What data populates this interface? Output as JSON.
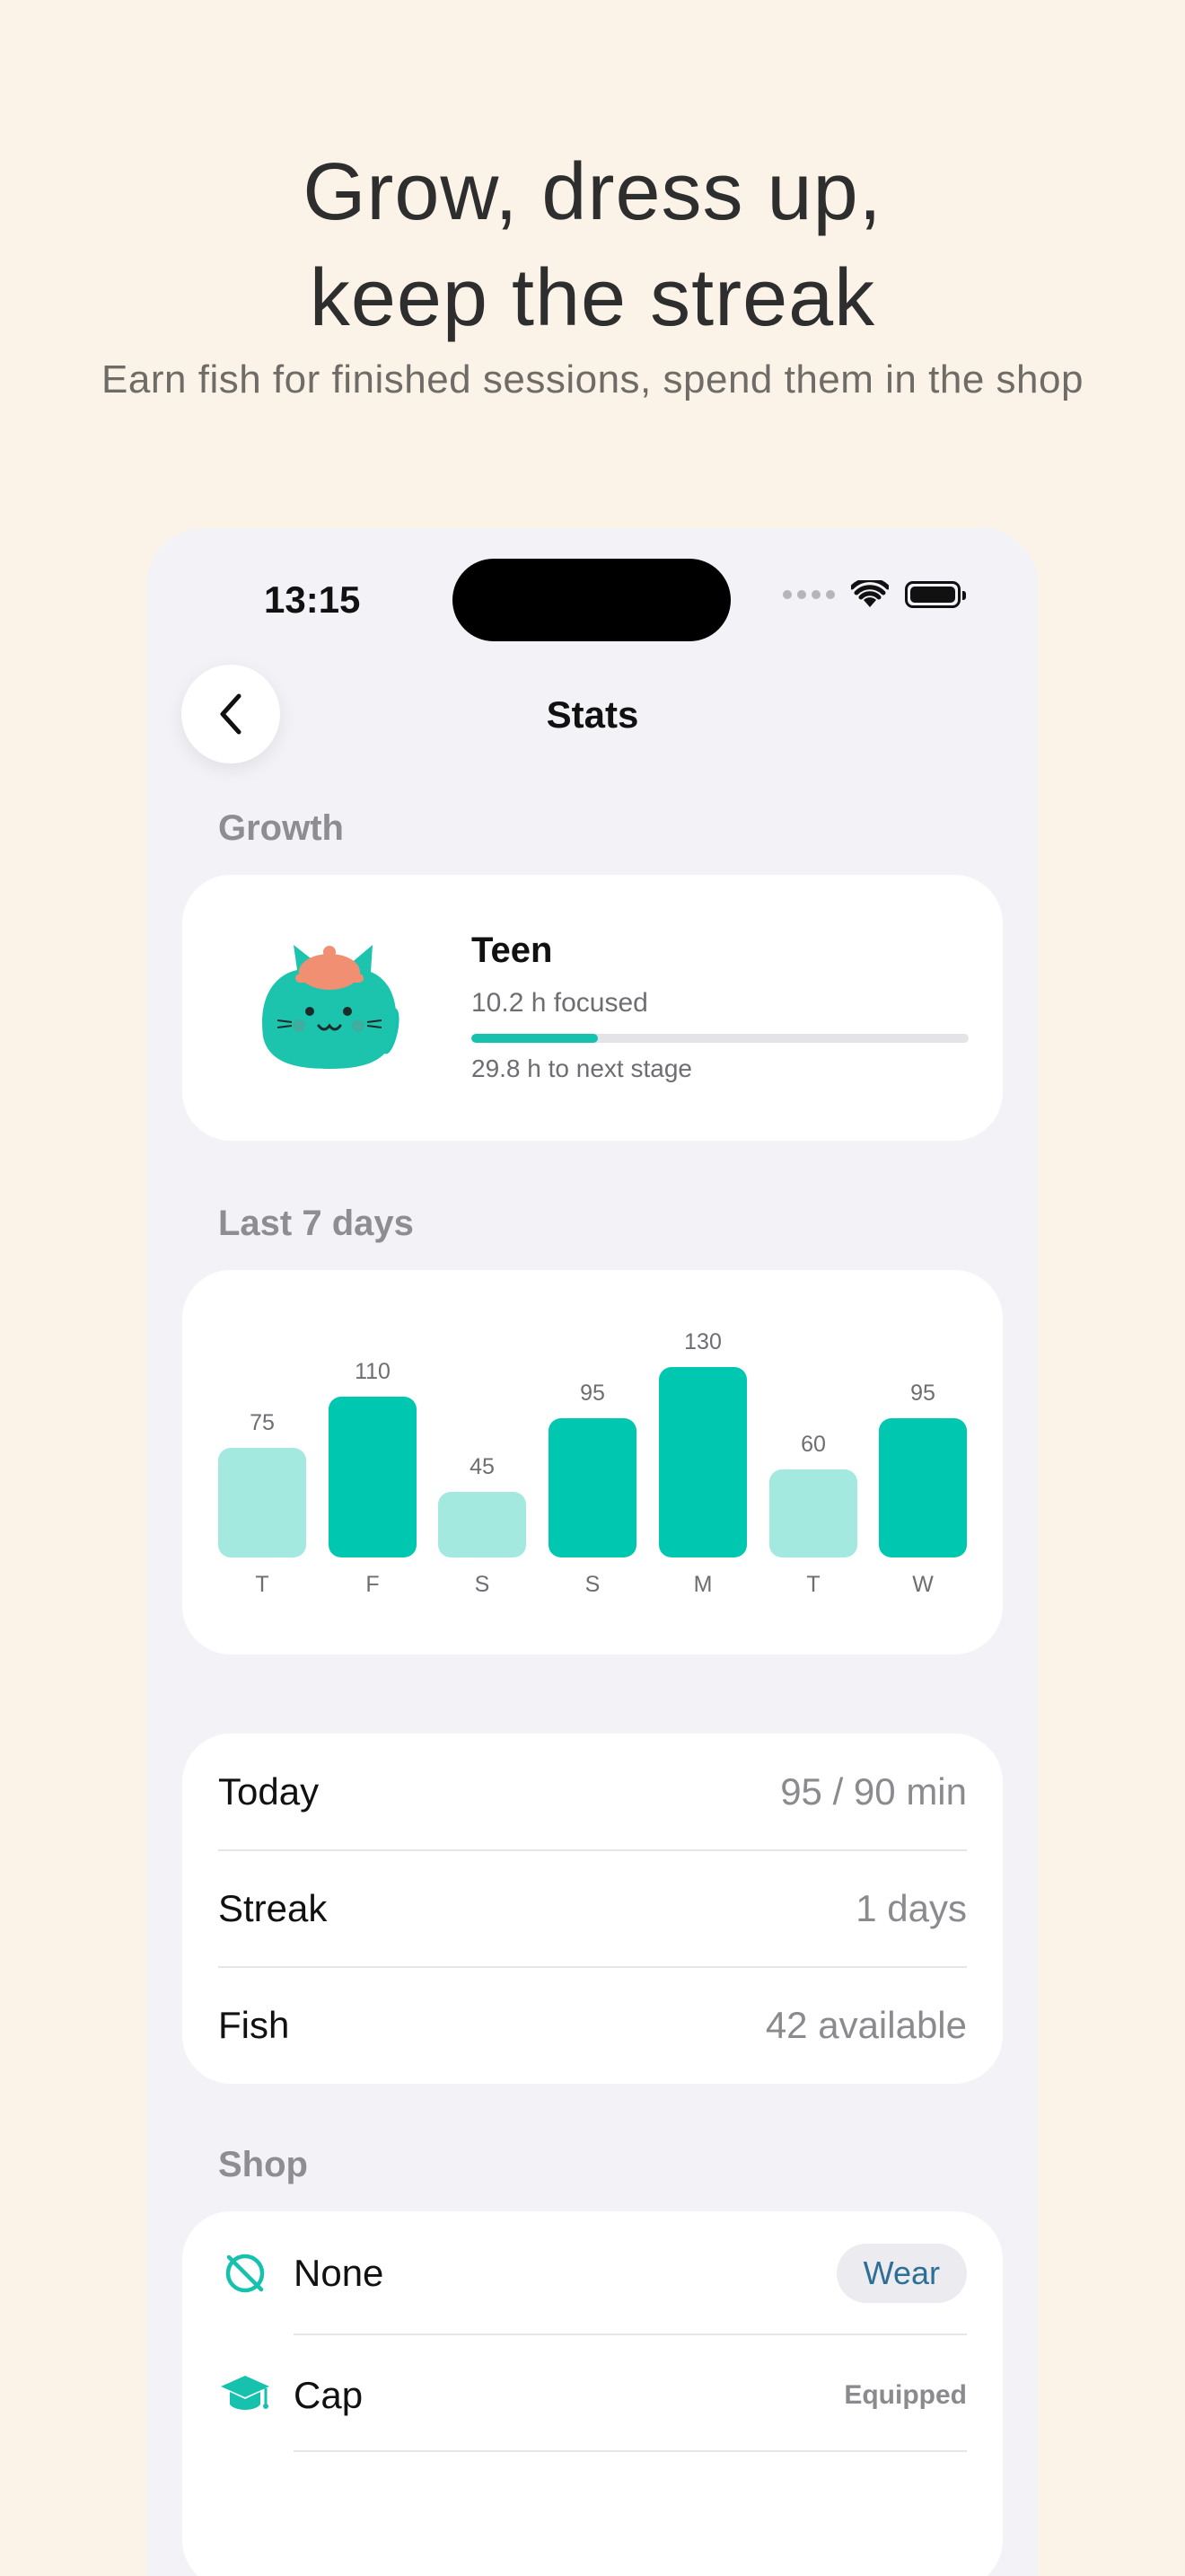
{
  "promo": {
    "headline_line1": "Grow, dress up,",
    "headline_line2": "keep the streak",
    "subline": "Earn fish for finished sessions, spend them in the shop"
  },
  "status_bar": {
    "time": "13:15"
  },
  "nav": {
    "title": "Stats",
    "back_icon": "chevron-left-icon"
  },
  "growth": {
    "section_label": "Growth",
    "stage": "Teen",
    "focused": "10.2 h focused",
    "next_stage": "29.8 h to next stage",
    "progress_fraction": 0.255
  },
  "last7": {
    "section_label": "Last 7 days"
  },
  "chart_data": {
    "type": "bar",
    "categories": [
      "T",
      "F",
      "S",
      "S",
      "M",
      "T",
      "W"
    ],
    "values": [
      75,
      110,
      45,
      95,
      130,
      60,
      95
    ],
    "highlight": [
      false,
      true,
      false,
      true,
      true,
      false,
      true
    ],
    "colors": {
      "highlight": "#00c7b0",
      "normal": "#a3e9e0"
    },
    "title": "",
    "xlabel": "",
    "ylabel": ""
  },
  "summary": {
    "rows": [
      {
        "label": "Today",
        "value": "95 / 90 min"
      },
      {
        "label": "Streak",
        "value": "1 days"
      },
      {
        "label": "Fish",
        "value": "42 available"
      }
    ]
  },
  "shop": {
    "section_label": "Shop",
    "items": [
      {
        "label": "None",
        "icon": "no-item-icon",
        "action": "Wear"
      },
      {
        "label": "Cap",
        "icon": "graduation-cap-icon",
        "status": "Equipped"
      }
    ]
  },
  "colors": {
    "accent": "#16c2ad",
    "background": "#fbf3e7",
    "screen": "#f2f2f7"
  }
}
